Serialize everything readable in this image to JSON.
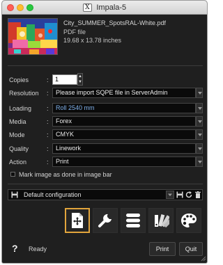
{
  "window": {
    "title": "Impala-5",
    "title_glyph": "X"
  },
  "file": {
    "name": "City_SUMMER_SpotsRAL-White.pdf",
    "type": "PDF file",
    "size": "19.68 x 13.78 inches"
  },
  "form": {
    "colon": ":",
    "copies": {
      "label": "Copies",
      "value": "1"
    },
    "resolution": {
      "label": "Resolution",
      "value": "Please import SQPE file in ServerAdmin"
    },
    "loading": {
      "label": "Loading",
      "value": "Roll 2540 mm"
    },
    "media": {
      "label": "Media",
      "value": "Forex"
    },
    "mode": {
      "label": "Mode",
      "value": "CMYK"
    },
    "quality": {
      "label": "Quality",
      "value": "Linework"
    },
    "action": {
      "label": "Action",
      "value": "Print"
    },
    "mark_image": {
      "label": "Mark image as done in image bar",
      "checked": false
    }
  },
  "configuration": {
    "selected": "Default configuration"
  },
  "toolbar": {
    "buttons": [
      {
        "icon": "layout-icon",
        "active": true
      },
      {
        "icon": "wrench-icon",
        "active": false
      },
      {
        "icon": "stack-icon",
        "active": false
      },
      {
        "icon": "swatches-icon",
        "active": false
      },
      {
        "icon": "palette-icon",
        "active": false
      }
    ]
  },
  "footer": {
    "help": "?",
    "status": "Ready",
    "print_label": "Print",
    "quit_label": "Quit"
  },
  "colors": {
    "accent": "#e2a53c",
    "loading_text": "#7fb0ea",
    "background": "#1f1f1f"
  }
}
